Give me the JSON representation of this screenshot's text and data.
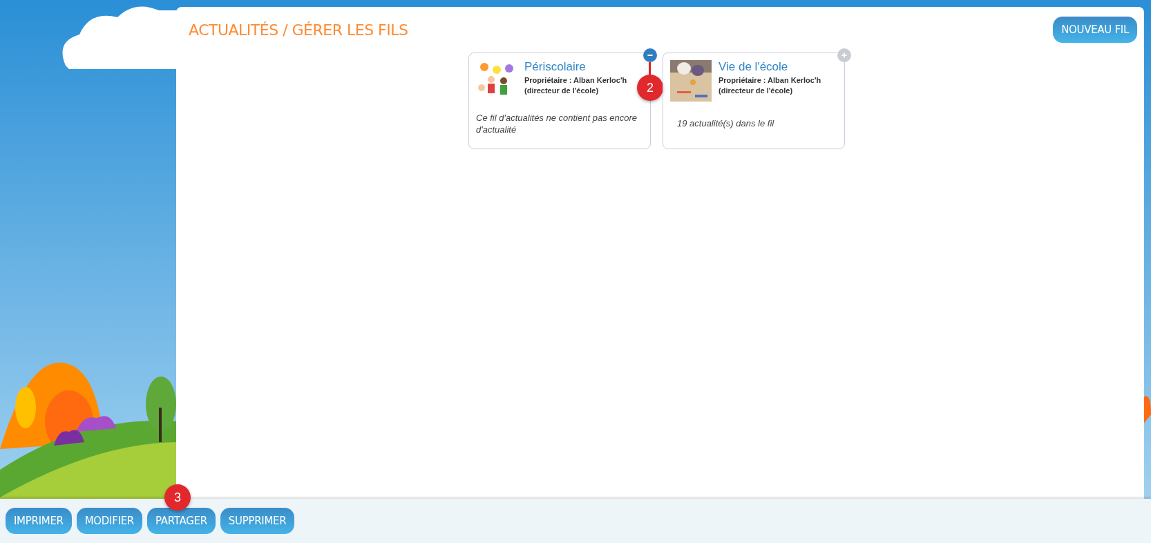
{
  "header": {
    "title": "ACTUALITÉS / GÉRER LES FILS",
    "new_button": "NOUVEAU FIL"
  },
  "cards": [
    {
      "title": "Périscolaire",
      "owner": "Propriétaire : Alban Kerloc'h (directeur de l'école)",
      "status": "Ce fil d'actualités ne contient pas encore d'actualité",
      "selected": true,
      "callout": "2"
    },
    {
      "title": "Vie de l'école",
      "owner": "Propriétaire : Alban Kerloc'h (directeur de l'école)",
      "status": "19 actualité(s) dans le fil",
      "selected": false
    }
  ],
  "toolbar": [
    {
      "label": "IMPRIMER"
    },
    {
      "label": "MODIFIER"
    },
    {
      "label": "PARTAGER",
      "callout": "3"
    },
    {
      "label": "SUPPRIMER"
    }
  ]
}
